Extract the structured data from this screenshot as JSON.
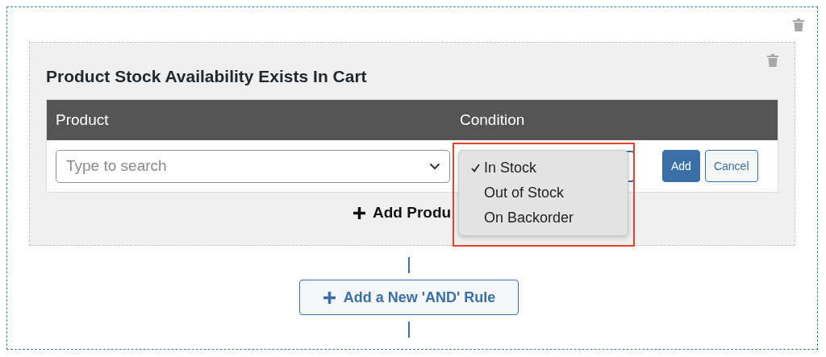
{
  "group": {
    "title": "Product Stock Availability Exists In Cart",
    "table": {
      "columns": [
        "Product",
        "Condition"
      ],
      "product_field": {
        "placeholder": "Type to search"
      },
      "buttons": [
        {
          "label": "Add",
          "kind": "primary"
        },
        {
          "label": "Cancel",
          "kind": "secondary"
        }
      ]
    },
    "add_product_button": {
      "label": "Add Produ"
    }
  },
  "condition_menu": {
    "highlighted": true,
    "options": [
      {
        "label": "In Stock",
        "selected": true
      },
      {
        "label": "Out of Stock",
        "selected": false
      },
      {
        "label": "On Backorder",
        "selected": false
      }
    ]
  },
  "add_rule_button": {
    "label": "Add a New 'AND' Rule"
  }
}
